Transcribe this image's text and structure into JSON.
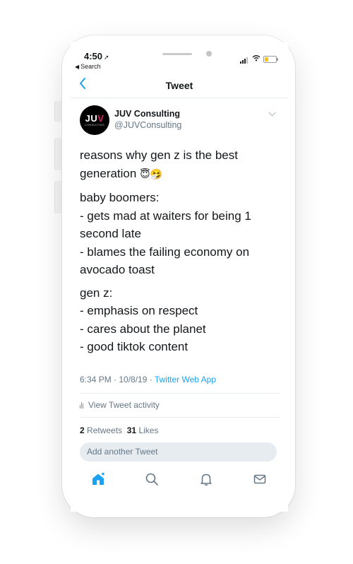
{
  "status_bar": {
    "time": "4:50",
    "location_glyph": "➚",
    "back_label": "Search"
  },
  "nav": {
    "title": "Tweet"
  },
  "author": {
    "name": "JUV Consulting",
    "handle": "@JUVConsulting",
    "avatar_logo_left": "JU",
    "avatar_logo_v": "V",
    "avatar_logo_sub": "CONSULTING"
  },
  "tweet": {
    "p1_line1": "reasons why gen z is the best",
    "p1_line2": "generation",
    "p1_emoji": "😇🤧",
    "p2_lines": [
      "baby boomers:",
      "- gets mad at waiters for being 1",
      "second late",
      "- blames the failing economy on",
      "avocado toast"
    ],
    "p3_lines": [
      "gen z:",
      "- emphasis on respect",
      "- cares about the planet",
      "- good tiktok content"
    ],
    "timestamp": "6:34 PM · 10/8/19 · ",
    "source": "Twitter Web App"
  },
  "activity_label": "View Tweet activity",
  "counts": {
    "retweets_count": "2",
    "retweets_label": "Retweets",
    "likes_count": "31",
    "likes_label": "Likes"
  },
  "reply_placeholder": "Add another Tweet",
  "tab_bar": {
    "items": [
      "home-icon",
      "search-icon",
      "notifications-icon",
      "messages-icon"
    ],
    "active": "home-icon"
  },
  "colors": {
    "accent": "#1da1f2",
    "secondary_text": "#657786",
    "divider": "#e6ecf0"
  }
}
